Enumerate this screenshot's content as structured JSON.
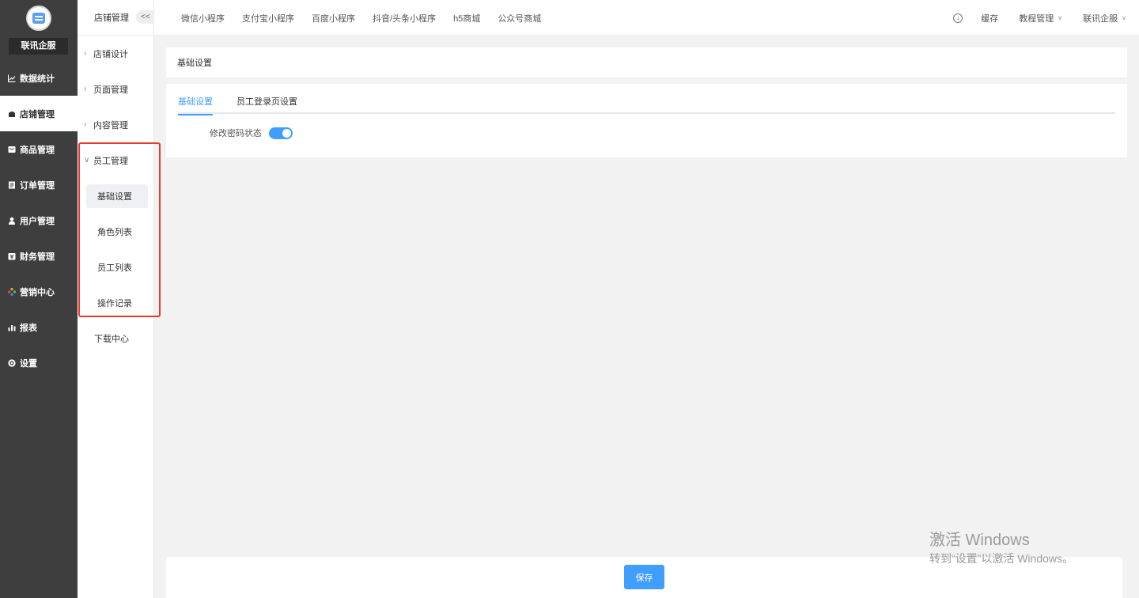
{
  "brand": {
    "name": "联讯企服"
  },
  "left_nav": [
    {
      "label": "数据统计",
      "icon": "chart-line-icon"
    },
    {
      "label": "店铺管理",
      "icon": "store-icon",
      "active": true
    },
    {
      "label": "商品管理",
      "icon": "goods-icon"
    },
    {
      "label": "订单管理",
      "icon": "order-icon"
    },
    {
      "label": "用户管理",
      "icon": "user-icon"
    },
    {
      "label": "财务管理",
      "icon": "finance-icon"
    },
    {
      "label": "营销中心",
      "icon": "marketing-icon"
    },
    {
      "label": "报表",
      "icon": "report-icon"
    },
    {
      "label": "设置",
      "icon": "gear-icon"
    }
  ],
  "sub_nav": {
    "header": "店铺管理",
    "collapse_label": "<<",
    "items": [
      {
        "label": "店铺设计"
      },
      {
        "label": "页面管理"
      },
      {
        "label": "内容管理"
      },
      {
        "label": "员工管理",
        "expanded": true
      }
    ],
    "children": [
      {
        "label": "基础设置",
        "active": true
      },
      {
        "label": "角色列表"
      },
      {
        "label": "员工列表"
      },
      {
        "label": "操作记录"
      }
    ],
    "download_center": "下载中心"
  },
  "topbar": {
    "tabs": [
      "微信小程序",
      "支付宝小程序",
      "百度小程序",
      "抖音/头条小程序",
      "h5商城",
      "公众号商城"
    ],
    "cache": "缓存",
    "tutorial": "教程管理",
    "account": "联讯企服"
  },
  "breadcrumb": "基础设置",
  "settings": {
    "tabs": [
      "基础设置",
      "员工登录页设置"
    ],
    "active_tab": 0,
    "password_status_label": "修改密码状态",
    "password_status_on": true
  },
  "footer": {
    "save_label": "保存"
  },
  "watermark": {
    "line1": "激活 Windows",
    "line2": "转到“设置”以激活 Windows。"
  },
  "colors": {
    "accent": "#409eff",
    "sidebar_bg": "#3e3e3e",
    "highlight": "#e8392b"
  }
}
